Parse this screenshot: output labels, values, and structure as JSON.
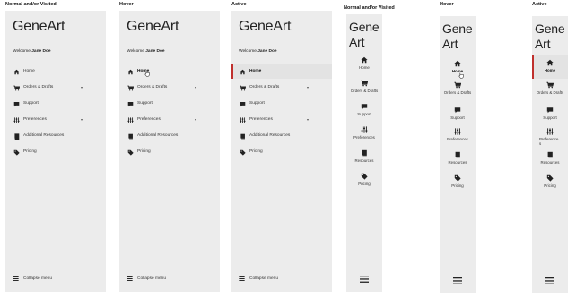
{
  "app": {
    "brand": "GeneArt",
    "brand_narrow_line1": "Gene",
    "brand_narrow_line2": "Art"
  },
  "states": {
    "normal": "Normal and/or Visited",
    "hover": "Hover",
    "active": "Active"
  },
  "welcome": {
    "prefix": "Welcome ",
    "user": "Jane Doe"
  },
  "nav": {
    "home": "Home",
    "orders": "Orders & Drafts",
    "support": "Support",
    "preferences": "Preferences",
    "resources_full": "Additional Resources",
    "resources_short": "Resources",
    "pricing": "Pricing",
    "collapse": "Collapse menu"
  },
  "narrow_active_pref": {
    "line1": "Preference",
    "line2": "s"
  },
  "icons": {
    "home": "home-icon",
    "orders": "cart-icon",
    "support": "chat-icon",
    "preferences": "sliders-icon",
    "resources": "book-icon",
    "pricing": "tag-icon",
    "collapse": "hamburger-icon",
    "cursor": "hand-cursor-icon"
  },
  "colors": {
    "panel_bg": "#ececec",
    "active_bar": "#c0302d",
    "text": "#222222"
  }
}
